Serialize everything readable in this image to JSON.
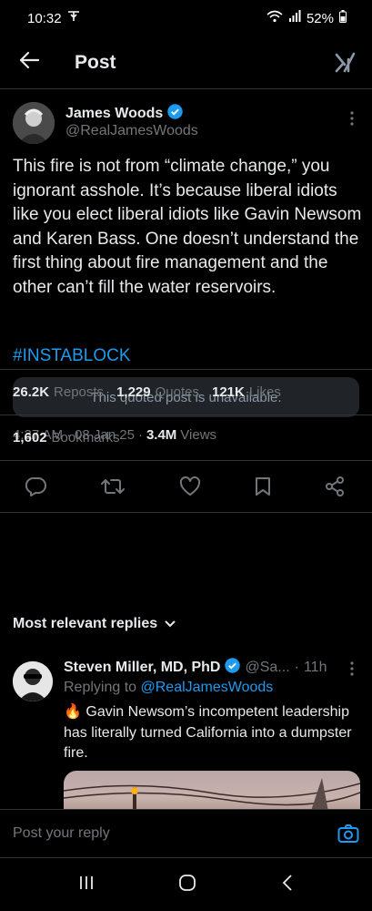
{
  "status_bar": {
    "time": "10:32",
    "battery": "52%"
  },
  "header": {
    "title": "Post"
  },
  "post": {
    "display_name": "James Woods",
    "handle": "@RealJamesWoods",
    "text": "This fire is not from “climate change,” you ignorant asshole. It’s because liberal idiots like you elect liberal idiots like Gavin Newsom and Karen Bass. One doesn’t understand the first thing about fire management and the other can’t fill the water reservoirs.",
    "hashtag": "#INSTABLOCK",
    "quoted_unavailable": "This quoted post is unavailable.",
    "time": "4:37 AM",
    "date": "08 Jan 25",
    "views_count": "3.4M",
    "views_label": "Views",
    "reposts_count": "26.2K",
    "reposts_label": "Reposts",
    "quotes_count": "1,229",
    "quotes_label": "Quotes",
    "likes_count": "121K",
    "likes_label": "Likes",
    "bookmarks_count": "1,602",
    "bookmarks_label": "Bookmarks"
  },
  "replies": {
    "heading": "Most relevant replies",
    "items": [
      {
        "display_name": "Steven Miller, MD, PhD",
        "handle": "@Sa...",
        "age": "11h",
        "replying_prefix": "Replying to",
        "replying_to": "@RealJamesWoods",
        "text": "🔥 Gavin Newsom’s incompetent leadership has literally turned California into a dumpster fire."
      }
    ]
  },
  "reply_bar": {
    "placeholder": "Post your reply"
  },
  "colors": {
    "accent": "#1d9bf0",
    "background": "#000000",
    "muted": "#71767b",
    "divider": "#2f3336"
  }
}
